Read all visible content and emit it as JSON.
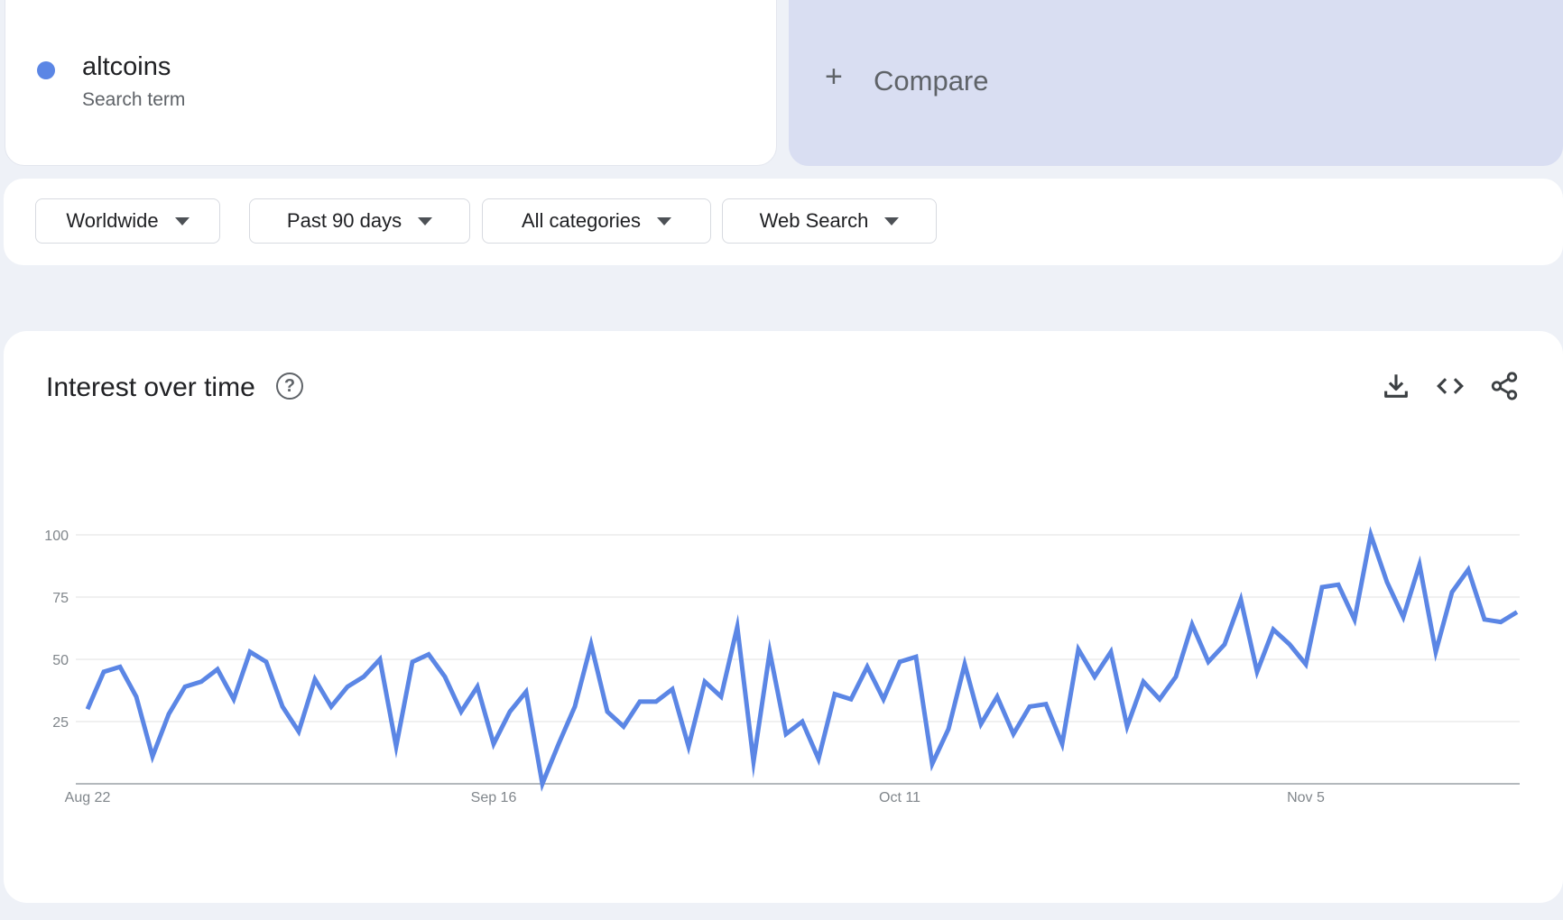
{
  "search_term": {
    "name": "altcoins",
    "type": "Search term",
    "color": "#5b86e5"
  },
  "compare": {
    "plus": "+",
    "label": "Compare"
  },
  "filters": [
    {
      "label": "Worldwide"
    },
    {
      "label": "Past 90 days"
    },
    {
      "label": "All categories"
    },
    {
      "label": "Web Search"
    }
  ],
  "panel": {
    "title": "Interest over time",
    "help_icon": "help-circle-icon",
    "help_glyph": "?",
    "tools": [
      "download-icon",
      "embed-code-icon",
      "share-icon"
    ]
  },
  "chart_data": {
    "type": "line",
    "x_ticks": [
      "Aug 22",
      "Sep 16",
      "Oct 11",
      "Nov 5"
    ],
    "y_ticks": [
      "25",
      "50",
      "75",
      "100"
    ],
    "ylim": [
      0,
      100
    ],
    "grid": true,
    "x_start": "Aug 22",
    "x_end": "Nov 19",
    "series": [
      {
        "color": "#5b86e5",
        "values": [
          30,
          45,
          47,
          35,
          11,
          28,
          39,
          41,
          46,
          34,
          53,
          49,
          31,
          21,
          42,
          31,
          39,
          43,
          50,
          15,
          49,
          52,
          43,
          29,
          39,
          16,
          29,
          37,
          0,
          16,
          31,
          56,
          29,
          23,
          33,
          33,
          38,
          15,
          41,
          35,
          63,
          9,
          53,
          20,
          25,
          10,
          36,
          34,
          47,
          34,
          49,
          51,
          8,
          22,
          48,
          24,
          35,
          20,
          31,
          32,
          16,
          54,
          43,
          53,
          23,
          41,
          34,
          43,
          64,
          49,
          56,
          74,
          45,
          62,
          56,
          48,
          79,
          80,
          66,
          100,
          81,
          67,
          88,
          53,
          77,
          86,
          66,
          65,
          69
        ]
      }
    ]
  }
}
